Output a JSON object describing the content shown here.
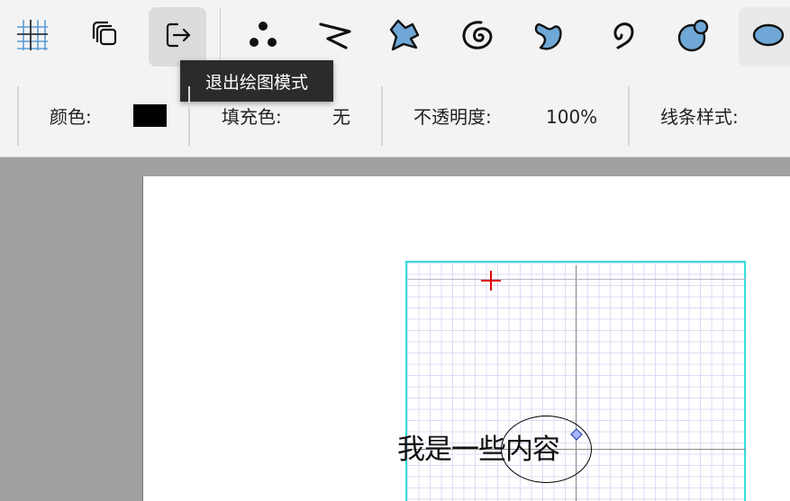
{
  "toolbar": {
    "tools": [
      {
        "name": "grid-tool",
        "icon": "grid-icon"
      },
      {
        "name": "layers-tool",
        "icon": "copy-layers-icon"
      },
      {
        "name": "exit-draw-tool",
        "icon": "exit-icon"
      },
      {
        "name": "dots-brush-tool",
        "icon": "dots-brush-icon"
      },
      {
        "name": "zigzag-brush-tool",
        "icon": "zigzag-icon"
      },
      {
        "name": "splash-shape-tool",
        "icon": "splash-icon"
      },
      {
        "name": "spiral-tool",
        "icon": "spiral-icon"
      },
      {
        "name": "blob-shape-tool",
        "icon": "blob-icon"
      },
      {
        "name": "curl-tool",
        "icon": "curl-icon"
      },
      {
        "name": "bubble-shape-tool",
        "icon": "bubble-icon"
      },
      {
        "name": "ellipse-shape-tool",
        "icon": "ellipse-icon"
      }
    ],
    "tooltip": "退出绘图模式",
    "accent": "#6fa8d6"
  },
  "properties": {
    "color_label": "颜色:",
    "color_value": "#000000",
    "fill_label": "填充色:",
    "fill_value": "无",
    "opacity_label": "不透明度:",
    "opacity_value": "100%",
    "line_style_label": "线条样式:"
  },
  "canvas": {
    "text": "我是一些内容",
    "grid_border_color": "#33e0dc",
    "cursor_color": "#e00000"
  }
}
